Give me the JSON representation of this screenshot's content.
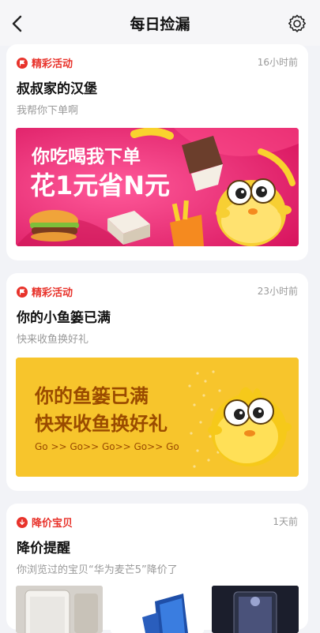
{
  "header": {
    "title": "每日捡漏",
    "back_icon": "back-arrow-icon",
    "settings_icon": "gear-icon"
  },
  "cards": [
    {
      "tag": "精彩活动",
      "tag_color": "#e8332b",
      "time": "16小时前",
      "title": "叔叔家的汉堡",
      "subtitle": "我帮你下单啊",
      "banner": {
        "line1": "你吃喝我下单",
        "line2": "花1元省N元",
        "bg": "#e5206d"
      }
    },
    {
      "tag": "精彩活动",
      "tag_color": "#e8332b",
      "time": "23小时前",
      "title": "你的小鱼篓已满",
      "subtitle": "快来收鱼换好礼",
      "banner": {
        "line1": "你的鱼篓已满",
        "line2": "快来收鱼换好礼",
        "line3": "Go >> Go>> Go>> Go>> Go",
        "bg": "#f7c52c"
      }
    },
    {
      "tag": "降价宝贝",
      "tag_color": "#e8332b",
      "time": "1天前",
      "title": "降价提醒",
      "subtitle": "你浏览过的宝贝“华为麦芒5”降价了"
    }
  ]
}
